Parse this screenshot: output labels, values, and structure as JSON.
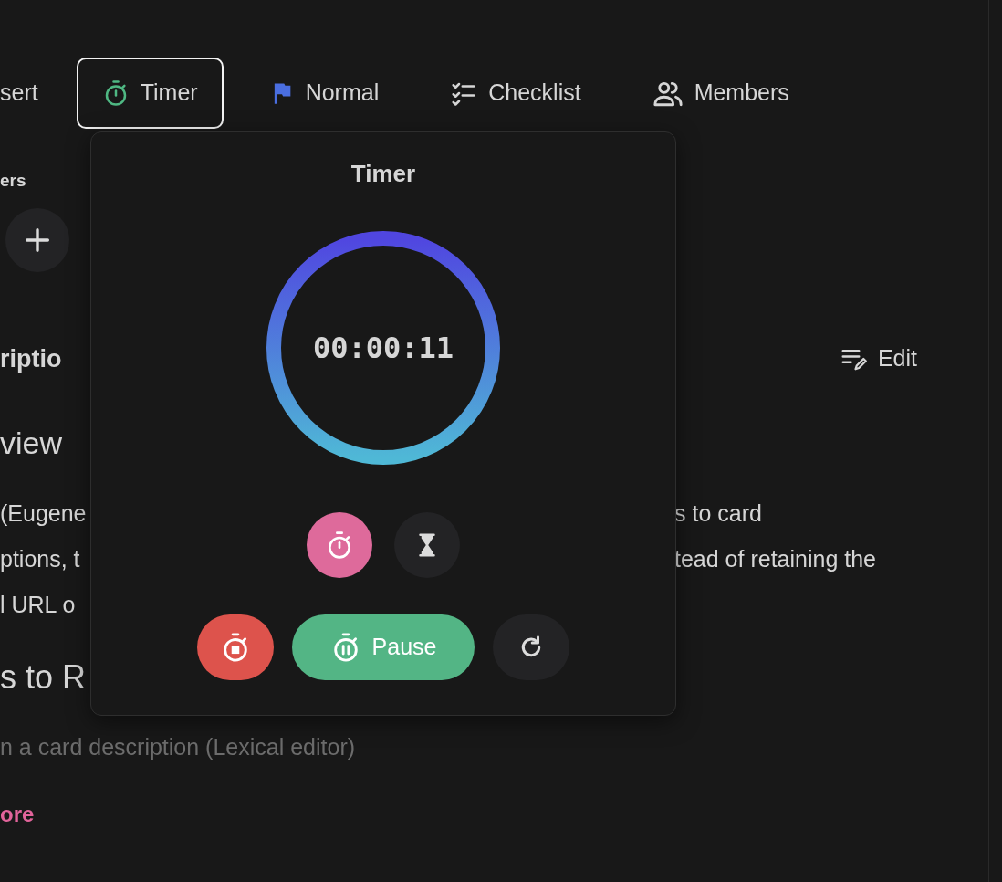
{
  "toolbar": [
    {
      "kind": "insert",
      "label": "sert",
      "selected": false
    },
    {
      "kind": "timer",
      "label": "Timer",
      "selected": true
    },
    {
      "kind": "priority",
      "label": "Normal",
      "selected": false
    },
    {
      "kind": "checklist",
      "label": "Checklist",
      "selected": false
    },
    {
      "kind": "members",
      "label": "Members",
      "selected": false
    }
  ],
  "members_label": "ers",
  "description": {
    "heading": "riptio",
    "edit_label": "Edit",
    "overview_heading": "view",
    "lines": [
      {
        "left": "(Eugene",
        "right": "s to card"
      },
      {
        "left": "ptions, t",
        "right": "tead of retaining the"
      },
      {
        "left": "l URL o"
      }
    ],
    "steps_heading": "s to R",
    "step": "n a card description (Lexical editor)",
    "more_link": "ore"
  },
  "timer_popover": {
    "title": "Timer",
    "time": "00:00:11",
    "modes": [
      {
        "kind": "stopwatch",
        "selected": true
      },
      {
        "kind": "countdown",
        "selected": false
      }
    ],
    "buttons": [
      {
        "kind": "stop"
      },
      {
        "kind": "pause",
        "label": "Pause"
      },
      {
        "kind": "reset"
      }
    ]
  }
}
